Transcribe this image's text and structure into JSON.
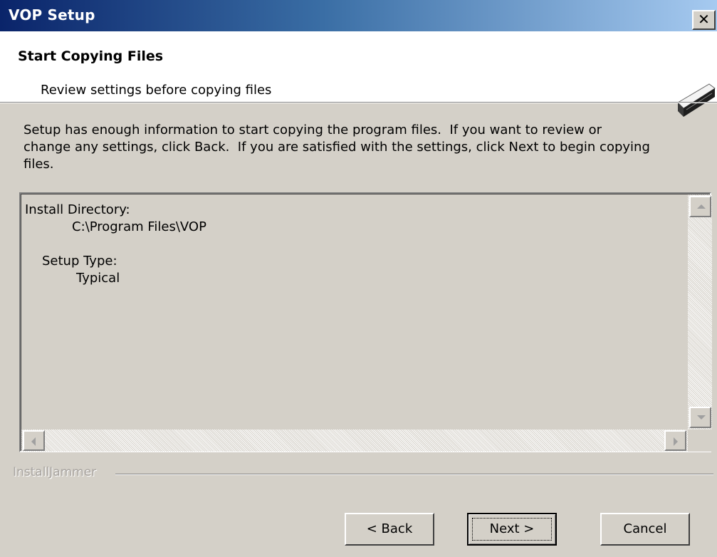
{
  "window": {
    "title": "VOP Setup",
    "close_glyph": "✕"
  },
  "header": {
    "title": "Start Copying Files",
    "subtitle": "Review settings before copying files",
    "icon": "install-disk-icon"
  },
  "intro_lines": [
    "Setup has enough information to start copying the program files.  If you want to review or",
    "change any settings, click Back.  If you are satisfied with the settings, click Next to begin copying",
    "files."
  ],
  "summary": {
    "install_dir_label": "Install Directory:",
    "install_dir_value": "C:\\Program Files\\VOP",
    "setup_type_label": "Setup Type:",
    "setup_type_value": "Typical"
  },
  "footer": {
    "brand": "InstallJammer"
  },
  "buttons": {
    "back": "< Back",
    "next": "Next >",
    "cancel": "Cancel"
  }
}
